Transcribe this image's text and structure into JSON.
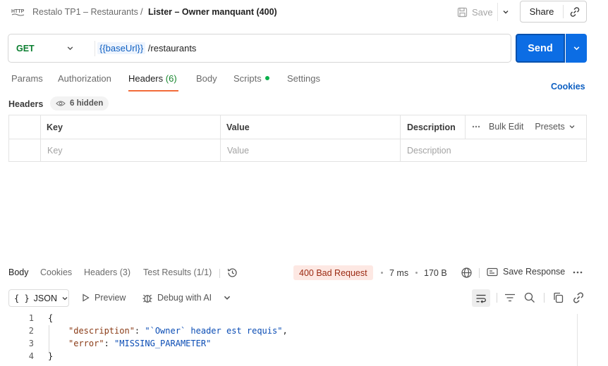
{
  "topbar": {
    "http_icon_label": "HTTP",
    "collection_path": "Restalo TP1 – Restaurants",
    "separator": "/",
    "request_name": "Lister – Owner manquant (400)",
    "save_label": "Save",
    "share_label": "Share"
  },
  "urlbar": {
    "method": "GET",
    "url_variable": "{{baseUrl}}",
    "url_path": " /restaurants",
    "send_label": "Send"
  },
  "request_tabs": {
    "params": "Params",
    "authorization": "Authorization",
    "headers": "Headers",
    "headers_count": "(6)",
    "body": "Body",
    "scripts": "Scripts",
    "settings": "Settings",
    "cookies": "Cookies"
  },
  "headers_section": {
    "title": "Headers",
    "hidden_label": "6 hidden"
  },
  "table": {
    "columns": [
      "Key",
      "Value",
      "Description"
    ],
    "placeholders": [
      "Key",
      "Value",
      "Description"
    ],
    "bulk_edit": "Bulk Edit",
    "presets": "Presets"
  },
  "response": {
    "tabs": {
      "body": "Body",
      "cookies": "Cookies",
      "headers": "Headers (3)",
      "test_results": "Test Results (1/1)"
    },
    "status": "400 Bad Request",
    "time": "7 ms",
    "size": "170 B",
    "save_response": "Save Response",
    "format": "JSON",
    "preview": "Preview",
    "debug": "Debug with AI",
    "lines": [
      {
        "num": "1",
        "open": "{"
      },
      {
        "num": "2",
        "key": "\"description\"",
        "sep": ": ",
        "value": "\"`Owner` header est requis\"",
        "tail": ","
      },
      {
        "num": "3",
        "key": "\"error\"",
        "sep": ": ",
        "value": "\"MISSING_PARAMETER\"",
        "tail": ""
      },
      {
        "num": "4",
        "close": "}"
      }
    ]
  },
  "colors": {
    "accent_blue": "#0c6de4",
    "method_green": "#0a7e2f",
    "tab_underline": "#f26b3a",
    "error_badge_bg": "#fde8e3",
    "error_badge_text": "#9b2a12"
  }
}
